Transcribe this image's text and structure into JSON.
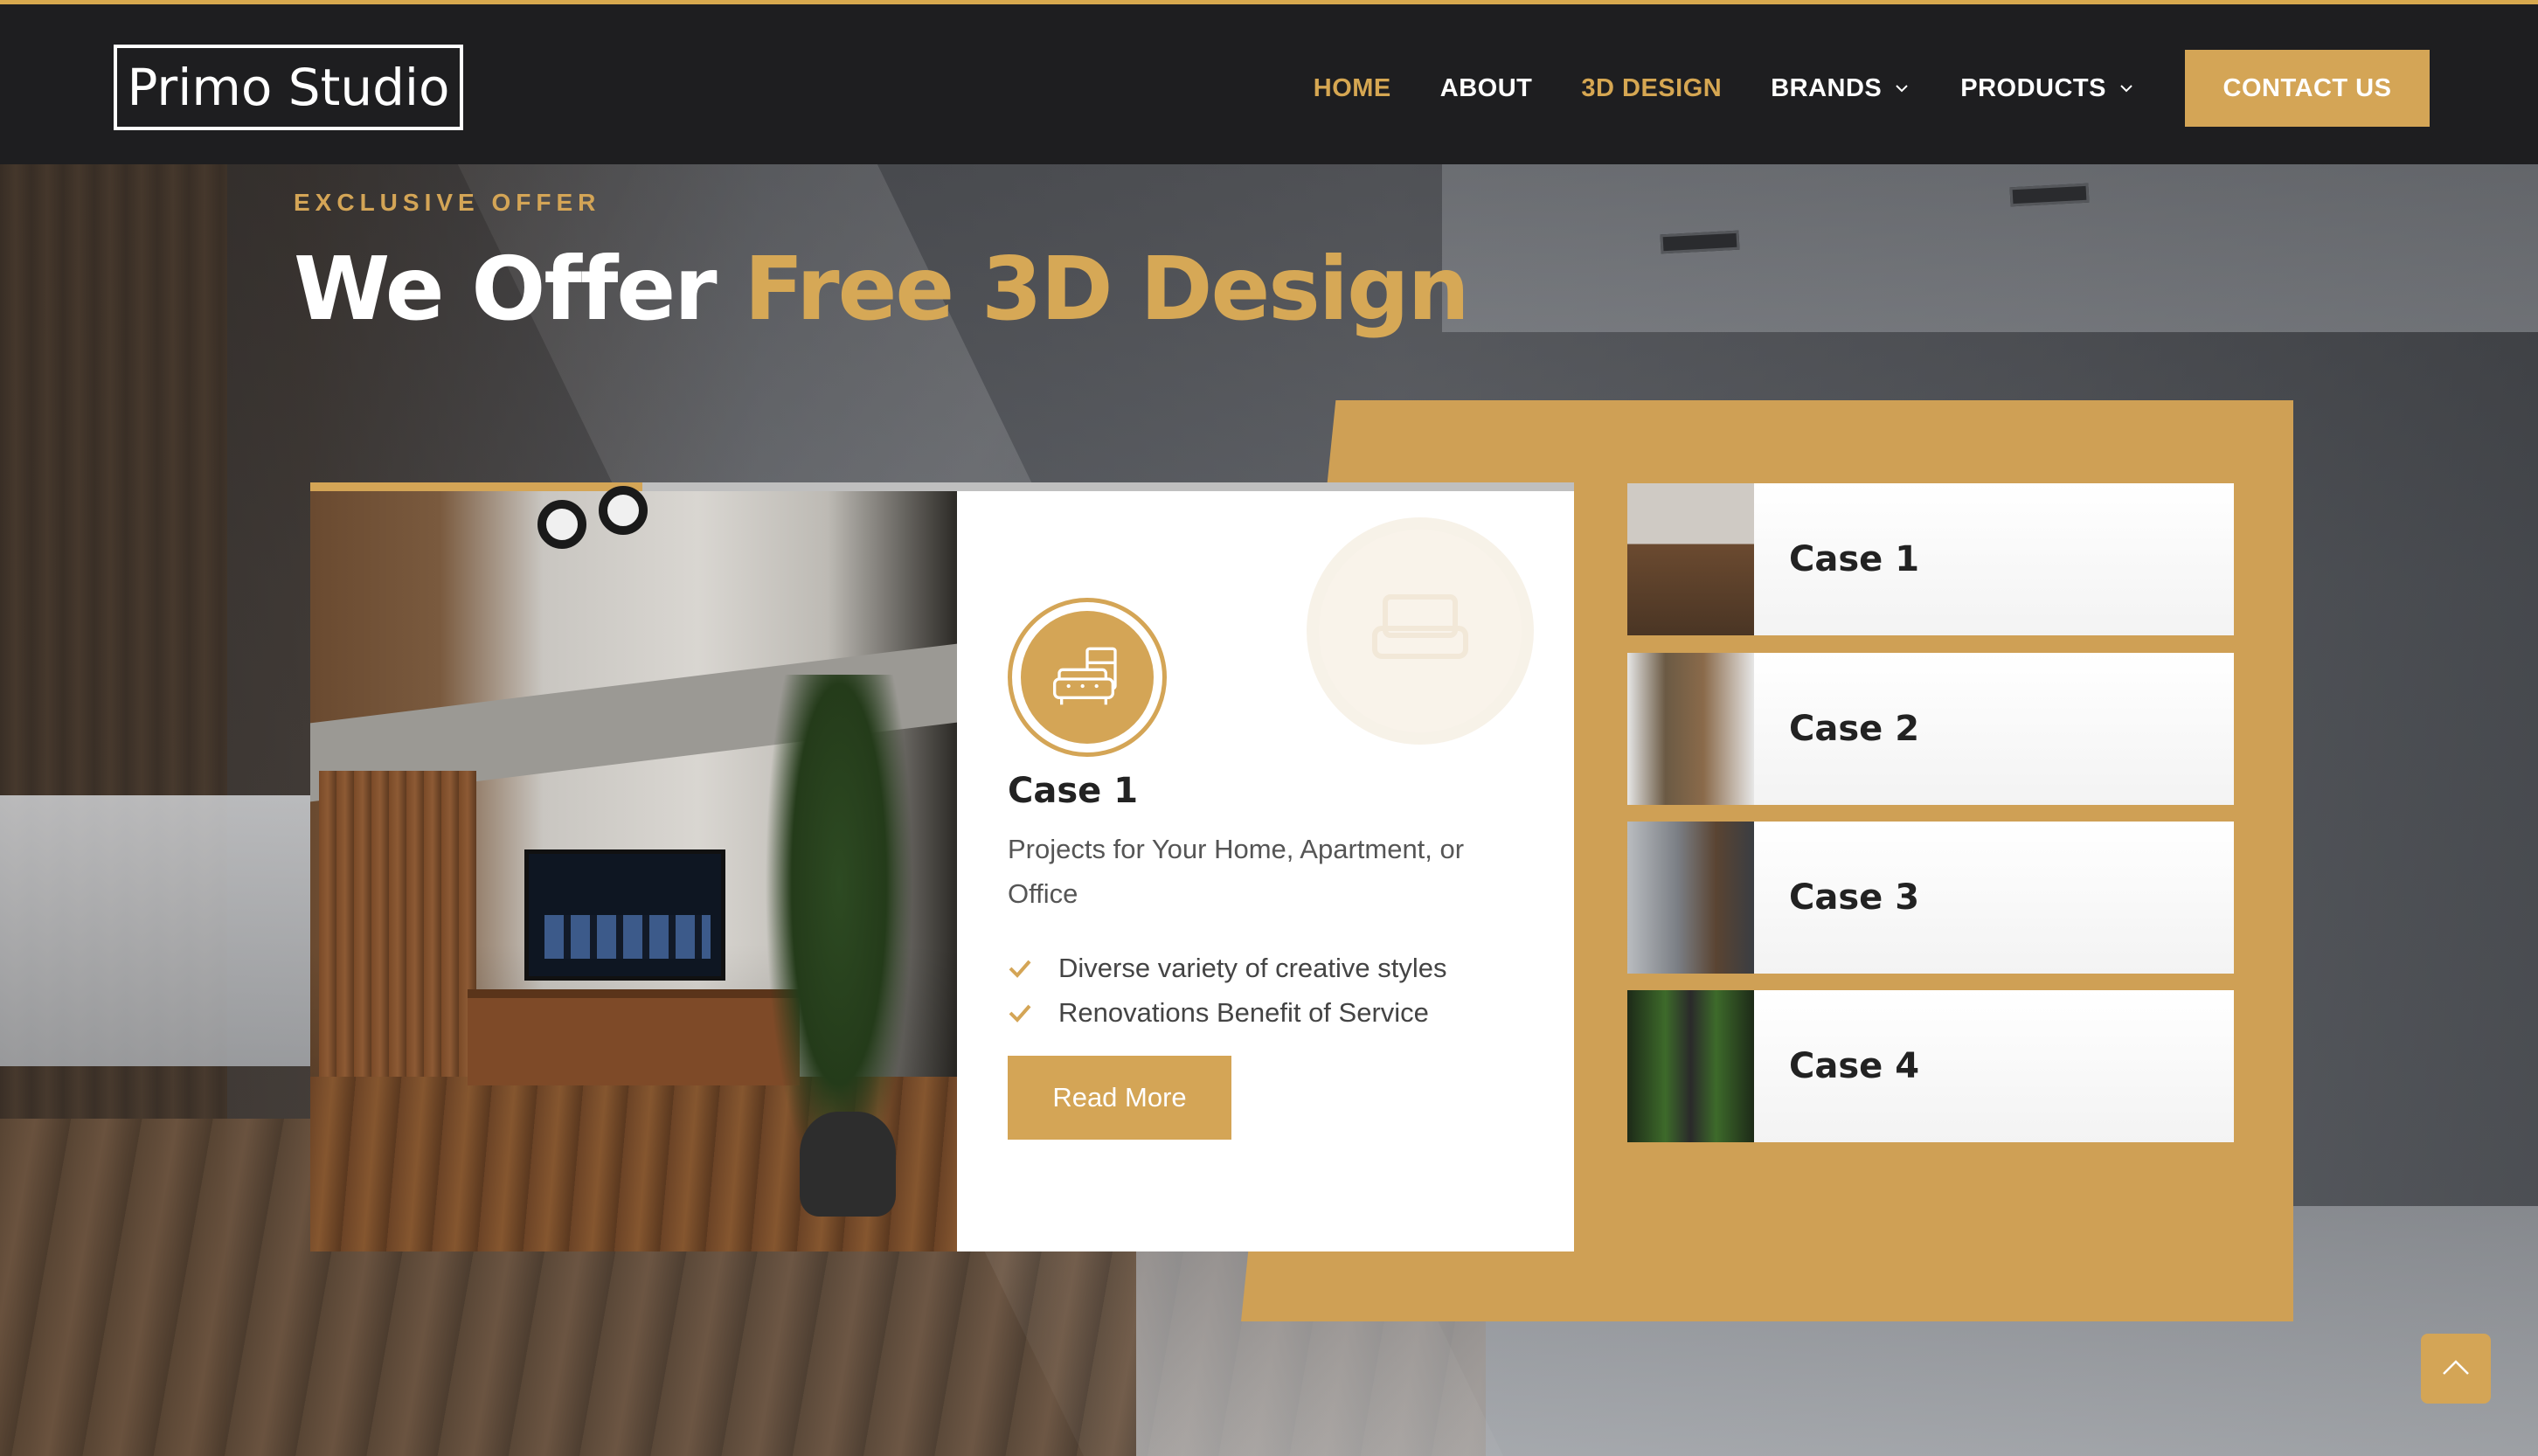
{
  "header": {
    "logo_text": "Primo Studio",
    "nav": [
      {
        "label": "HOME",
        "active": true
      },
      {
        "label": "ABOUT",
        "active": false
      },
      {
        "label": "3D DESIGN",
        "active": true
      },
      {
        "label": "BRANDS",
        "has_dropdown": true
      },
      {
        "label": "PRODUCTS",
        "has_dropdown": true
      }
    ],
    "contact_label": "CONTACT US"
  },
  "hero": {
    "eyebrow": "EXCLUSIVE OFFER",
    "headline_white": "We Offer ",
    "headline_gold": "Free 3D Design"
  },
  "feature": {
    "icon": "sofa-icon",
    "title": "Case 1",
    "description": "Projects for Your Home, Apartment, or Office",
    "bullets": [
      "Diverse variety of creative styles",
      "Renovations Benefit of Service"
    ],
    "button_label": "Read More"
  },
  "cases": [
    {
      "label": "Case 1"
    },
    {
      "label": "Case 2"
    },
    {
      "label": "Case 3"
    },
    {
      "label": "Case 4"
    }
  ],
  "colors": {
    "accent": "#d4a556",
    "header_bg": "#1e1e20",
    "text_dark": "#222222"
  },
  "scroll_top_icon": "chevron-up-icon"
}
